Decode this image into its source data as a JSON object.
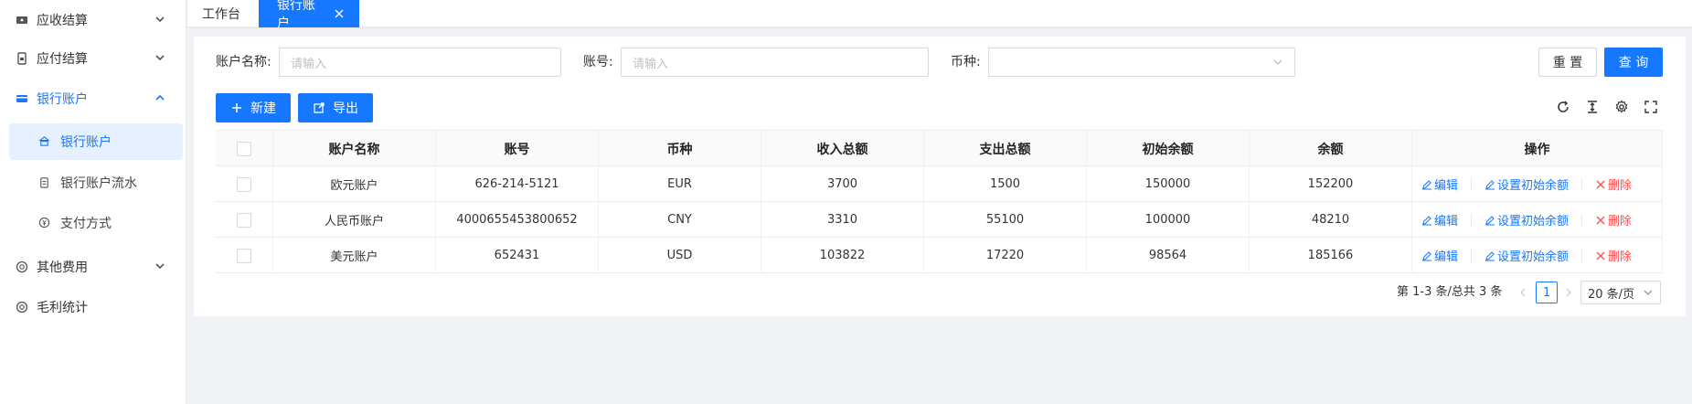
{
  "sidebar": {
    "items": [
      {
        "label": "应收结算",
        "icon": "ticket-icon"
      },
      {
        "label": "应付结算",
        "icon": "receipt-icon"
      },
      {
        "label": "银行账户",
        "icon": "card-icon"
      },
      {
        "label": "其他费用",
        "icon": "coin-icon"
      },
      {
        "label": "毛利统计",
        "icon": "coin-icon"
      }
    ],
    "sub_items": [
      {
        "label": "银行账户",
        "icon": "bank-icon"
      },
      {
        "label": "银行账户流水",
        "icon": "clipboard-icon"
      },
      {
        "label": "支付方式",
        "icon": "yuan-icon"
      }
    ]
  },
  "tabs": [
    {
      "label": "工作台"
    },
    {
      "label": "银行账户"
    }
  ],
  "filters": {
    "account_name_label": "账户名称:",
    "account_name_placeholder": "请输入",
    "account_no_label": "账号:",
    "account_no_placeholder": "请输入",
    "currency_label": "币种:",
    "currency_value": ""
  },
  "buttons": {
    "reset": "重 置",
    "search": "查 询",
    "new": "新建",
    "export": "导出"
  },
  "table": {
    "columns": [
      "账户名称",
      "账号",
      "币种",
      "收入总额",
      "支出总额",
      "初始余额",
      "余额",
      "操作"
    ],
    "rows": [
      {
        "name": "欧元账户",
        "account": "626-214-5121",
        "currency": "EUR",
        "income": "3700",
        "expense": "1500",
        "initial": "150000",
        "balance": "152200"
      },
      {
        "name": "人民币账户",
        "account": "4000655453800652",
        "currency": "CNY",
        "income": "3310",
        "expense": "55100",
        "initial": "100000",
        "balance": "48210"
      },
      {
        "name": "美元账户",
        "account": "652431",
        "currency": "USD",
        "income": "103822",
        "expense": "17220",
        "initial": "98564",
        "balance": "185166"
      }
    ],
    "ops": {
      "edit": "编辑",
      "set_initial": "设置初始余额",
      "delete": "删除"
    }
  },
  "pagination": {
    "summary": "第 1-3 条/总共 3 条",
    "current": "1",
    "page_size": "20 条/页"
  },
  "colors": {
    "primary": "#1677ff",
    "danger": "#ff4d4f"
  }
}
